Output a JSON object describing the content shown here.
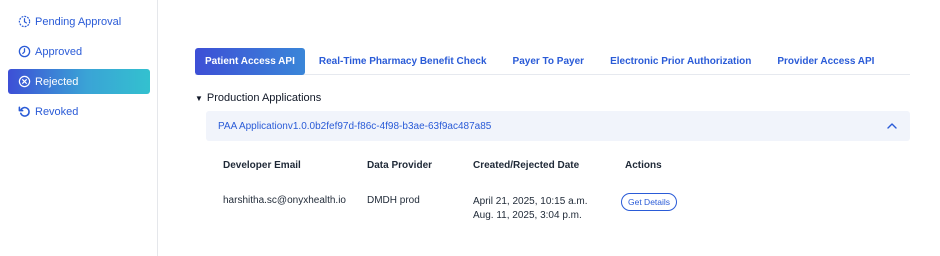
{
  "sidebar": {
    "items": [
      {
        "label": "Pending Approval",
        "icon": "clock-icon"
      },
      {
        "label": "Approved",
        "icon": "approved-clock-icon"
      },
      {
        "label": "Rejected",
        "icon": "x-circle-icon",
        "active": true
      },
      {
        "label": "Revoked",
        "icon": "revoke-arrow-icon"
      }
    ]
  },
  "tabs": [
    {
      "label": "Patient Access API",
      "active": true
    },
    {
      "label": "Real-Time Pharmacy Benefit Check"
    },
    {
      "label": "Payer To Payer"
    },
    {
      "label": "Electronic Prior Authorization"
    },
    {
      "label": "Provider Access API"
    }
  ],
  "section": {
    "title": "Production Applications"
  },
  "application": {
    "name": "PAA Applicationv1.0.0b2fef97d-f86c-4f98-b3ae-63f9ac487a85",
    "expanded": true
  },
  "table": {
    "headers": [
      "Developer Email",
      "Data Provider",
      "Created/Rejected Date",
      "Actions"
    ],
    "rows": [
      {
        "email": "harshitha.sc@onyxhealth.io",
        "provider": "DMDH prod",
        "created": "April 21, 2025, 10:15 a.m.",
        "rejected": "Aug. 11, 2025, 3:04 p.m.",
        "action": "Get Details"
      }
    ]
  },
  "colors": {
    "accent": "#2a5bd7",
    "gradient_start": "#3d4fd6",
    "gradient_end": "#33c1cf",
    "accordion_bg": "#f1f4fb"
  }
}
